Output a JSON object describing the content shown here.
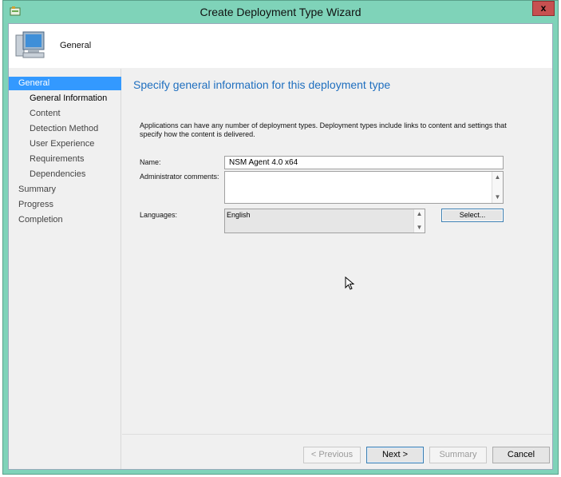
{
  "window": {
    "title": "Create Deployment Type Wizard",
    "close_label": "x",
    "accent_color": "#7fd3b9"
  },
  "header": {
    "title": "General",
    "icon": "computer-monitor-icon"
  },
  "nav": {
    "items": [
      {
        "label": "General",
        "level": "top",
        "state": "active"
      },
      {
        "label": "General Information",
        "level": "sub",
        "state": "current"
      },
      {
        "label": "Content",
        "level": "sub",
        "state": "normal"
      },
      {
        "label": "Detection Method",
        "level": "sub",
        "state": "normal"
      },
      {
        "label": "User Experience",
        "level": "sub",
        "state": "normal"
      },
      {
        "label": "Requirements",
        "level": "sub",
        "state": "normal"
      },
      {
        "label": "Dependencies",
        "level": "sub",
        "state": "normal"
      },
      {
        "label": "Summary",
        "level": "top",
        "state": "normal"
      },
      {
        "label": "Progress",
        "level": "top",
        "state": "normal"
      },
      {
        "label": "Completion",
        "level": "top",
        "state": "normal"
      }
    ]
  },
  "main": {
    "heading": "Specify general information for this deployment type",
    "description": "Applications can have any number of deployment types. Deployment types include links to content and settings that specify how the content is delivered.",
    "name_label": "Name:",
    "name_value": "NSM Agent 4.0 x64",
    "comments_label": "Administrator comments:",
    "comments_value": "",
    "languages_label": "Languages:",
    "languages_value": "English",
    "select_button": "Select..."
  },
  "footer": {
    "previous": "< Previous",
    "next": "Next >",
    "summary": "Summary",
    "cancel": "Cancel"
  }
}
